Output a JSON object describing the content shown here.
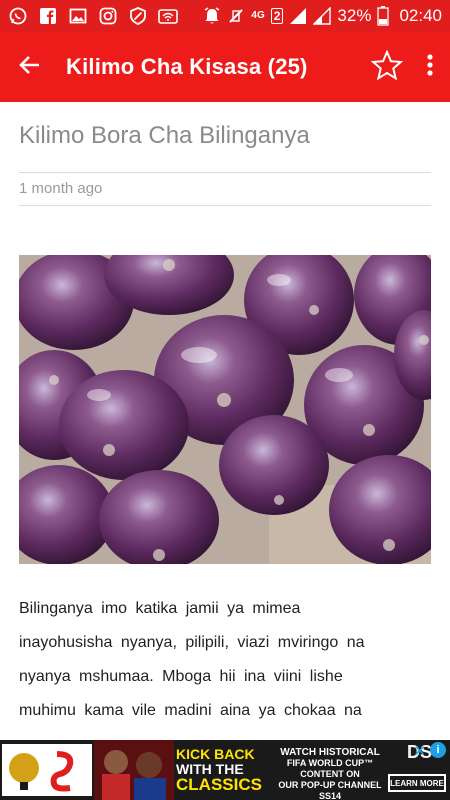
{
  "status_bar": {
    "battery_percent": "32%",
    "time": "02:40",
    "network_label": "4G",
    "sim_slot": "2",
    "icons": [
      "whatsapp-icon",
      "facebook-icon",
      "gallery-icon",
      "instagram-icon",
      "shield-icon",
      "wifi-icon",
      "alarm-icon",
      "vibrate-icon",
      "signal-icon",
      "battery-icon"
    ]
  },
  "app_bar": {
    "title": "Kilimo Cha Kisasa (25)",
    "back_icon": "arrow-back-icon",
    "star_icon": "star-outline-icon",
    "menu_icon": "more-vert-icon"
  },
  "article": {
    "title": "Kilimo Bora Cha Bilinganya",
    "date": "1 month ago",
    "body": [
      "Bilinganya imo katika jamii ya mimea",
      "inayohusisha nyanya, pilipili, viazi mviringo na",
      "nyanya mshumaa. Mboga hii ina viini lishe",
      "muhimu kama vile madini aina ya chokaa na"
    ]
  },
  "ad": {
    "headline_1": "KICK BACK",
    "headline_2": "WITH THE",
    "headline_3": "CLASSICS",
    "text_1": "WATCH HISTORICAL",
    "text_2": "FIFA WORLD CUP™ CONTENT ON",
    "text_3": "OUR POP-UP CHANNEL SS14",
    "brand": "DS",
    "cta": "LEARN MORE",
    "info": "i",
    "close": "✕"
  },
  "colors": {
    "status_bar": "#e01e1e",
    "app_bar": "#ee1b1b",
    "title_gray": "#8a8a8a"
  }
}
